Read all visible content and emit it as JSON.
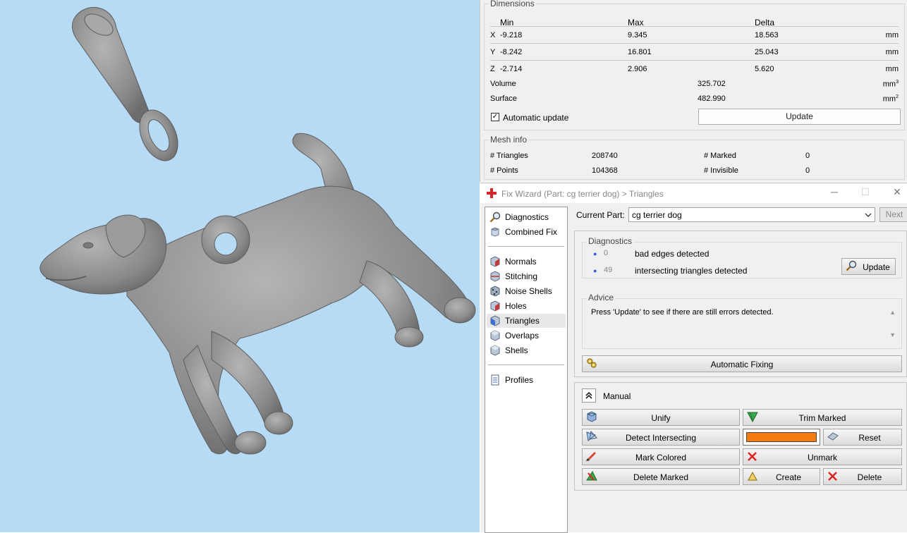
{
  "dimensions": {
    "title": "Dimensions",
    "headers": [
      "Min",
      "Max",
      "Delta"
    ],
    "rows": [
      {
        "axis": "X",
        "min": "-9.218",
        "max": "9.345",
        "delta": "18.563",
        "unit": "mm"
      },
      {
        "axis": "Y",
        "min": "-8.242",
        "max": "16.801",
        "delta": "25.043",
        "unit": "mm"
      },
      {
        "axis": "Z",
        "min": "-2.714",
        "max": "2.906",
        "delta": "5.620",
        "unit": "mm"
      }
    ],
    "volume_label": "Volume",
    "volume_value": "325.702",
    "volume_unit": "mm",
    "surface_label": "Surface",
    "surface_value": "482.990",
    "surface_unit": "mm",
    "auto_update_label": "Automatic update",
    "auto_update_checked": true,
    "update_button": "Update"
  },
  "mesh_info": {
    "title": "Mesh info",
    "triangles_label": "# Triangles",
    "triangles_value": "208740",
    "points_label": "# Points",
    "points_value": "104368",
    "marked_label": "# Marked",
    "marked_value": "0",
    "invisible_label": "# Invisible",
    "invisible_value": "0"
  },
  "wizard": {
    "title": "Fix Wizard (Part: cg terrier dog) > Triangles",
    "current_part_label": "Current Part:",
    "current_part_value": "cg terrier dog",
    "next_button": "Next",
    "steps_top": [
      {
        "label": "Diagnostics",
        "icon": "magnifier-icon"
      },
      {
        "label": "Combined Fix",
        "icon": "cube-stack-icon"
      }
    ],
    "steps_mid": [
      {
        "label": "Normals",
        "icon": "normals-cube-icon"
      },
      {
        "label": "Stitching",
        "icon": "stitching-cube-icon"
      },
      {
        "label": "Noise Shells",
        "icon": "noise-shells-icon"
      },
      {
        "label": "Holes",
        "icon": "holes-cube-icon"
      },
      {
        "label": "Triangles",
        "icon": "triangles-cube-icon",
        "active": true
      },
      {
        "label": "Overlaps",
        "icon": "overlaps-cube-icon"
      },
      {
        "label": "Shells",
        "icon": "shells-cube-icon"
      }
    ],
    "steps_bottom": [
      {
        "label": "Profiles",
        "icon": "document-icon"
      }
    ],
    "diagnostics": {
      "title": "Diagnostics",
      "items": [
        {
          "count": "0",
          "text": "bad edges detected"
        },
        {
          "count": "49",
          "text": "intersecting triangles detected"
        }
      ],
      "update_button": "Update"
    },
    "advice": {
      "title": "Advice",
      "text": "Press 'Update' to see if there are still errors detected."
    },
    "automatic_fixing_button": "Automatic Fixing",
    "manual": {
      "title": "Manual",
      "unify": "Unify",
      "trim_marked": "Trim Marked",
      "detect_intersecting": "Detect Intersecting",
      "reset": "Reset",
      "mark_colored": "Mark Colored",
      "unmark": "Unmark",
      "delete_marked": "Delete Marked",
      "create": "Create",
      "delete": "Delete",
      "mark_color": "#f57c10"
    }
  },
  "colors": {
    "viewport_bg": "#b7dbf5",
    "model_gray": "#8f8f8f"
  }
}
